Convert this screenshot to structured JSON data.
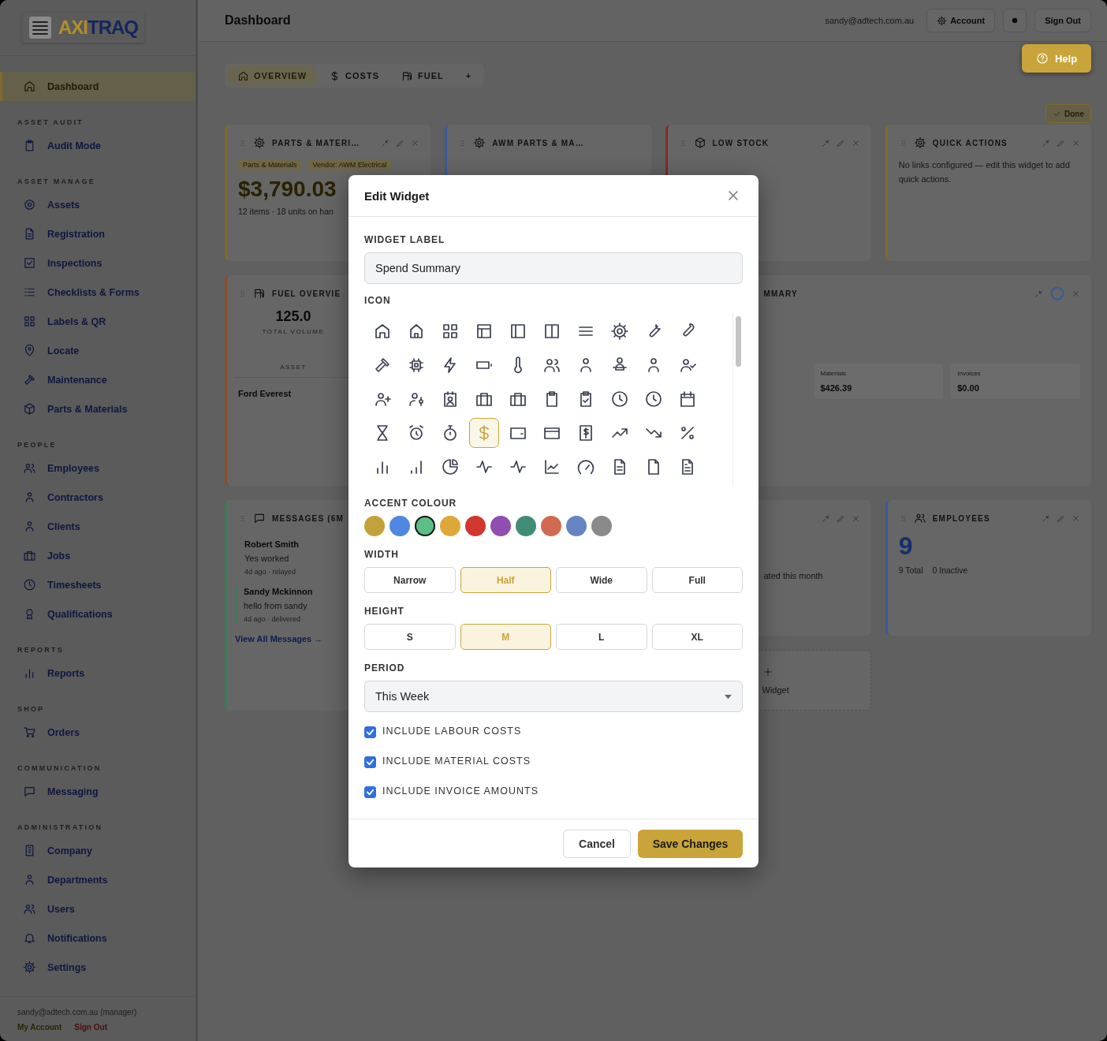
{
  "sidebar": {
    "logo_parts": [
      "AXI",
      "TRAQ"
    ],
    "sections": [
      {
        "items": [
          {
            "label": "Dashboard",
            "selected": true
          }
        ]
      },
      {
        "heading": "ASSET AUDIT",
        "items": [
          {
            "label": "Audit Mode",
            "selected": false
          }
        ]
      },
      {
        "heading": "ASSET MANAGE",
        "items": [
          {
            "label": "Assets",
            "selected": false
          },
          {
            "label": "Registration",
            "selected": false
          },
          {
            "label": "Inspections",
            "selected": false
          },
          {
            "label": "Checklists & Forms",
            "selected": false
          },
          {
            "label": "Labels & QR",
            "selected": false
          },
          {
            "label": "Locate",
            "selected": false
          },
          {
            "label": "Maintenance",
            "selected": false
          },
          {
            "label": "Parts & Materials",
            "selected": false
          }
        ]
      },
      {
        "heading": "PEOPLE",
        "items": [
          {
            "label": "Employees",
            "selected": false
          },
          {
            "label": "Contractors",
            "selected": false
          },
          {
            "label": "Clients",
            "selected": false
          },
          {
            "label": "Jobs",
            "selected": false
          },
          {
            "label": "Timesheets",
            "selected": false
          },
          {
            "label": "Qualifications",
            "selected": false
          }
        ]
      },
      {
        "heading": "REPORTS",
        "items": [
          {
            "label": "Reports",
            "selected": false
          }
        ]
      },
      {
        "heading": "SHOP",
        "items": [
          {
            "label": "Orders",
            "selected": false
          }
        ]
      },
      {
        "heading": "COMMUNICATION",
        "items": [
          {
            "label": "Messaging",
            "selected": false
          }
        ]
      },
      {
        "heading": "ADMINISTRATION",
        "items": [
          {
            "label": "Company",
            "selected": false
          },
          {
            "label": "Departments",
            "selected": false
          },
          {
            "label": "Users",
            "selected": false
          },
          {
            "label": "Notifications",
            "selected": false
          },
          {
            "label": "Settings",
            "selected": false
          }
        ]
      }
    ],
    "footer": {
      "user": "sandy@adtech.com.au (manager)",
      "links": [
        {
          "label": "My Account",
          "kind": "account"
        },
        {
          "label": "Sign Out",
          "kind": "danger"
        }
      ]
    }
  },
  "header": {
    "title": "Dashboard",
    "email": "sandy@adtech.com.au",
    "buttons": [
      {
        "kind": "account",
        "label": "Account"
      },
      {
        "kind": "theme"
      },
      {
        "kind": "plain",
        "label": "Sign Out"
      }
    ]
  },
  "help_button": "Help",
  "tabs": [
    {
      "label": "OVERVIEW",
      "selected": true
    },
    {
      "label": "COSTS",
      "selected": false
    },
    {
      "label": "FUEL",
      "selected": false
    },
    {
      "label": "+",
      "selected": false
    }
  ],
  "done_button": "Done",
  "widgets": [
    {
      "kind": "parts",
      "color": "#7f6a2c",
      "title": "PARTS & MATERI…",
      "tags": [
        "Parts & Materials",
        "Vendor: AWM Electrical"
      ],
      "value": "$3,790.03",
      "sub": "12 items · 18 units on han"
    },
    {
      "kind": "awm",
      "color": "#3a5a96",
      "title": "AWM PARTS & MA…"
    },
    {
      "kind": "low_stock",
      "color": "#862a24",
      "title": "LOW STOCK"
    },
    {
      "kind": "quick_actions",
      "color": "#7f6a2c",
      "title": "QUICK ACTIONS",
      "text": "No links configured — edit this widget to add quick actions."
    },
    {
      "kind": "fuel",
      "color": "#8f4a2b",
      "title": "FUEL OVERVIE",
      "value": "125.0",
      "caption": "TOTAL VOLUME",
      "column": "ASSET",
      "row": "Ford Everest"
    },
    {
      "kind": "spend",
      "title": "MMARY",
      "stats": [
        {
          "label": "Materials",
          "value": "$426.39"
        },
        {
          "label": "Invoices",
          "value": "$0.00"
        }
      ]
    },
    {
      "kind": "messages",
      "color": "#3f7a58",
      "title": "MESSAGES (6M",
      "messages": [
        {
          "name": "Robert Smith",
          "text": "Yes worked",
          "meta": "4d ago · relayed"
        },
        {
          "name": "Sandy Mckinnon",
          "text": "hello from sandy",
          "meta": "4d ago · delivered"
        }
      ],
      "link": "View All Messages →"
    },
    {
      "kind": "recent",
      "text": "ated this month"
    },
    {
      "kind": "employees",
      "color": "#3a5a96",
      "title": "EMPLOYEES",
      "value": "9",
      "stats": [
        "9 Total",
        "0 Inactive"
      ]
    },
    {
      "kind": "add",
      "text": "Widget"
    }
  ],
  "dialog": {
    "title": "Edit Widget",
    "label_heading": "WIDGET LABEL",
    "label_value": "Spend Summary",
    "icon_heading": "ICON",
    "icons": [
      {
        "selected": false
      },
      {
        "selected": false
      },
      {
        "selected": false
      },
      {
        "selected": false
      },
      {
        "selected": false
      },
      {
        "selected": false
      },
      {
        "selected": false
      },
      {
        "selected": false
      },
      {
        "selected": false
      },
      {
        "selected": false
      },
      {
        "selected": false
      },
      {
        "selected": false
      },
      {
        "selected": false
      },
      {
        "selected": false
      },
      {
        "selected": false
      },
      {
        "selected": false
      },
      {
        "selected": false
      },
      {
        "selected": false
      },
      {
        "selected": false
      },
      {
        "selected": false
      },
      {
        "selected": false
      },
      {
        "selected": false
      },
      {
        "selected": false
      },
      {
        "selected": false
      },
      {
        "selected": false
      },
      {
        "selected": false
      },
      {
        "selected": false
      },
      {
        "selected": false
      },
      {
        "selected": false
      },
      {
        "selected": false
      },
      {
        "selected": false
      },
      {
        "selected": false
      },
      {
        "selected": false
      },
      {
        "selected": true
      },
      {
        "selected": false
      },
      {
        "selected": false
      },
      {
        "selected": false
      },
      {
        "selected": false
      },
      {
        "selected": false
      },
      {
        "selected": false
      },
      {
        "selected": false
      },
      {
        "selected": false
      },
      {
        "selected": false
      },
      {
        "selected": false
      },
      {
        "selected": false
      },
      {
        "selected": false
      },
      {
        "selected": false
      },
      {
        "selected": false
      },
      {
        "selected": false
      },
      {
        "selected": false
      }
    ],
    "colour_heading": "ACCENT COLOUR",
    "colours": [
      {
        "color": "#c4a23a",
        "selected": false
      },
      {
        "color": "#4f87e3",
        "selected": false
      },
      {
        "color": "#5cbf86",
        "selected": true
      },
      {
        "color": "#dea737",
        "selected": false
      },
      {
        "color": "#d0372e",
        "selected": false
      },
      {
        "color": "#8e4fb0",
        "selected": false
      },
      {
        "color": "#3f8c77",
        "selected": false
      },
      {
        "color": "#d06a50",
        "selected": false
      },
      {
        "color": "#6585c2",
        "selected": false
      },
      {
        "color": "#8a8a8a",
        "selected": false
      }
    ],
    "width_heading": "WIDTH",
    "widths": [
      {
        "label": "Narrow",
        "selected": false
      },
      {
        "label": "Half",
        "selected": true
      },
      {
        "label": "Wide",
        "selected": false
      },
      {
        "label": "Full",
        "selected": false
      }
    ],
    "height_heading": "HEIGHT",
    "heights": [
      {
        "label": "S",
        "selected": false
      },
      {
        "label": "M",
        "selected": true
      },
      {
        "label": "L",
        "selected": false
      },
      {
        "label": "XL",
        "selected": false
      }
    ],
    "period_heading": "PERIOD",
    "period": "This Week",
    "options": [
      {
        "label": "INCLUDE LABOUR COSTS",
        "checked": true
      },
      {
        "label": "INCLUDE MATERIAL COSTS",
        "checked": true
      },
      {
        "label": "INCLUDE INVOICE AMOUNTS",
        "checked": true
      }
    ],
    "cancel": "Cancel",
    "save": "Save Changes"
  }
}
